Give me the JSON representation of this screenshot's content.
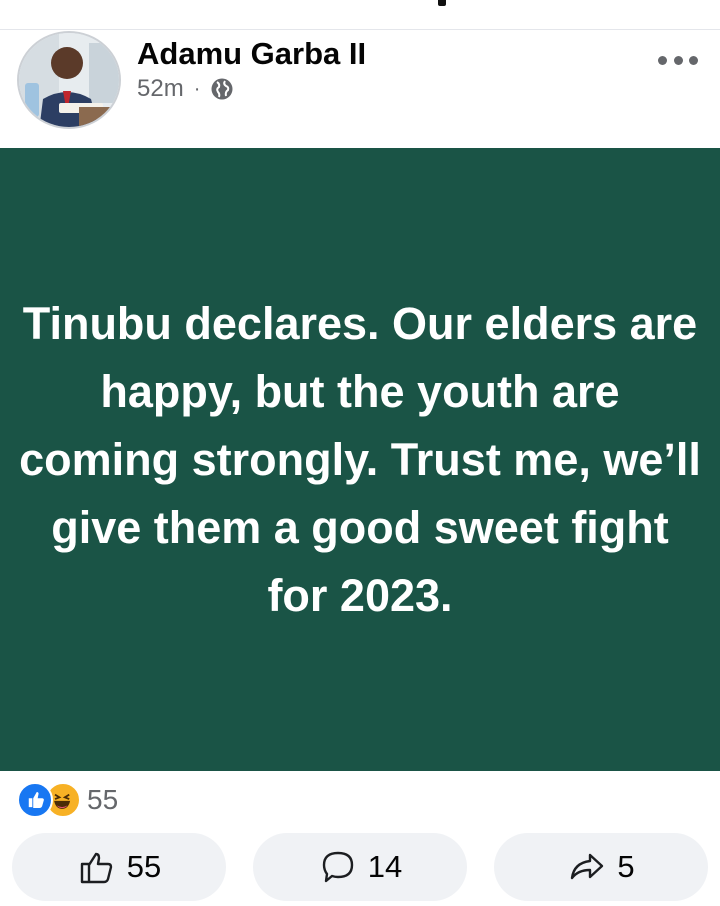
{
  "post": {
    "author": "Adamu Garba II",
    "time": "52m",
    "separator": "·",
    "text": "Tinubu declares. Our elders are happy, but the youth are coming strongly. Trust me, we’ll give them a good sweet fight for 2023.",
    "background_color": "#1a5446",
    "reactions": {
      "types": [
        "like-icon",
        "haha-icon"
      ],
      "count": "55"
    },
    "actions": {
      "like_count": "55",
      "comment_count": "14",
      "share_count": "5"
    }
  },
  "colors": {
    "accent": "#1877f2",
    "muted_text": "#65676b",
    "button_bg": "#f0f2f5"
  }
}
